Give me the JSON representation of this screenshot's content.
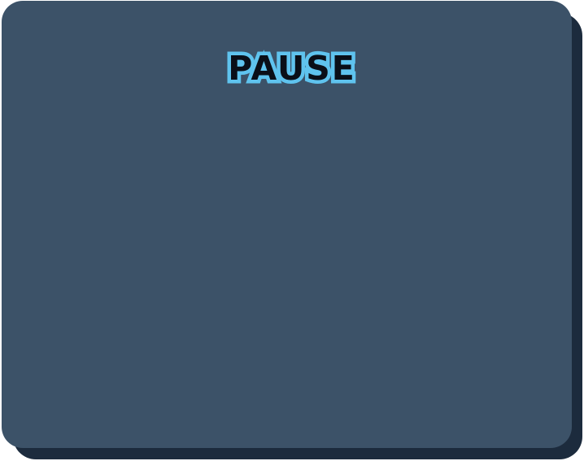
{
  "pause_menu": {
    "title": "PAUSE"
  },
  "colors": {
    "panel": "#3c5268",
    "panel_shadow": "#1c2b3d",
    "title_fill": "#0a0f18",
    "title_outline": "#5fc3ee"
  }
}
